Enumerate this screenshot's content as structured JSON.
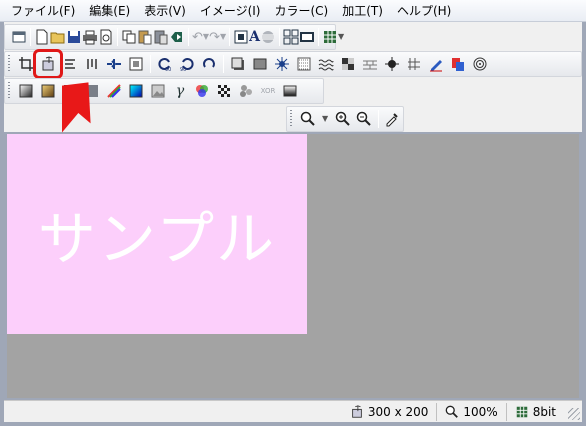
{
  "menu": [
    "ファイル(F)",
    "編集(E)",
    "表示(V)",
    "イメージ(I)",
    "カラー(C)",
    "加工(T)",
    "ヘルプ(H)"
  ],
  "canvas": {
    "text": "サンプル",
    "background": "#fccffb",
    "text_color": "#ffffff"
  },
  "status": {
    "size": "300 x 200",
    "zoom": "100%",
    "depth": "8bit"
  },
  "colors": {
    "workspace": "#a3a3a3",
    "highlight": "#e01818",
    "arrow": "#e81818"
  },
  "toolbar1": {
    "text_tool_label": "A"
  },
  "toolbar3": {
    "xor_label": "XOR"
  }
}
